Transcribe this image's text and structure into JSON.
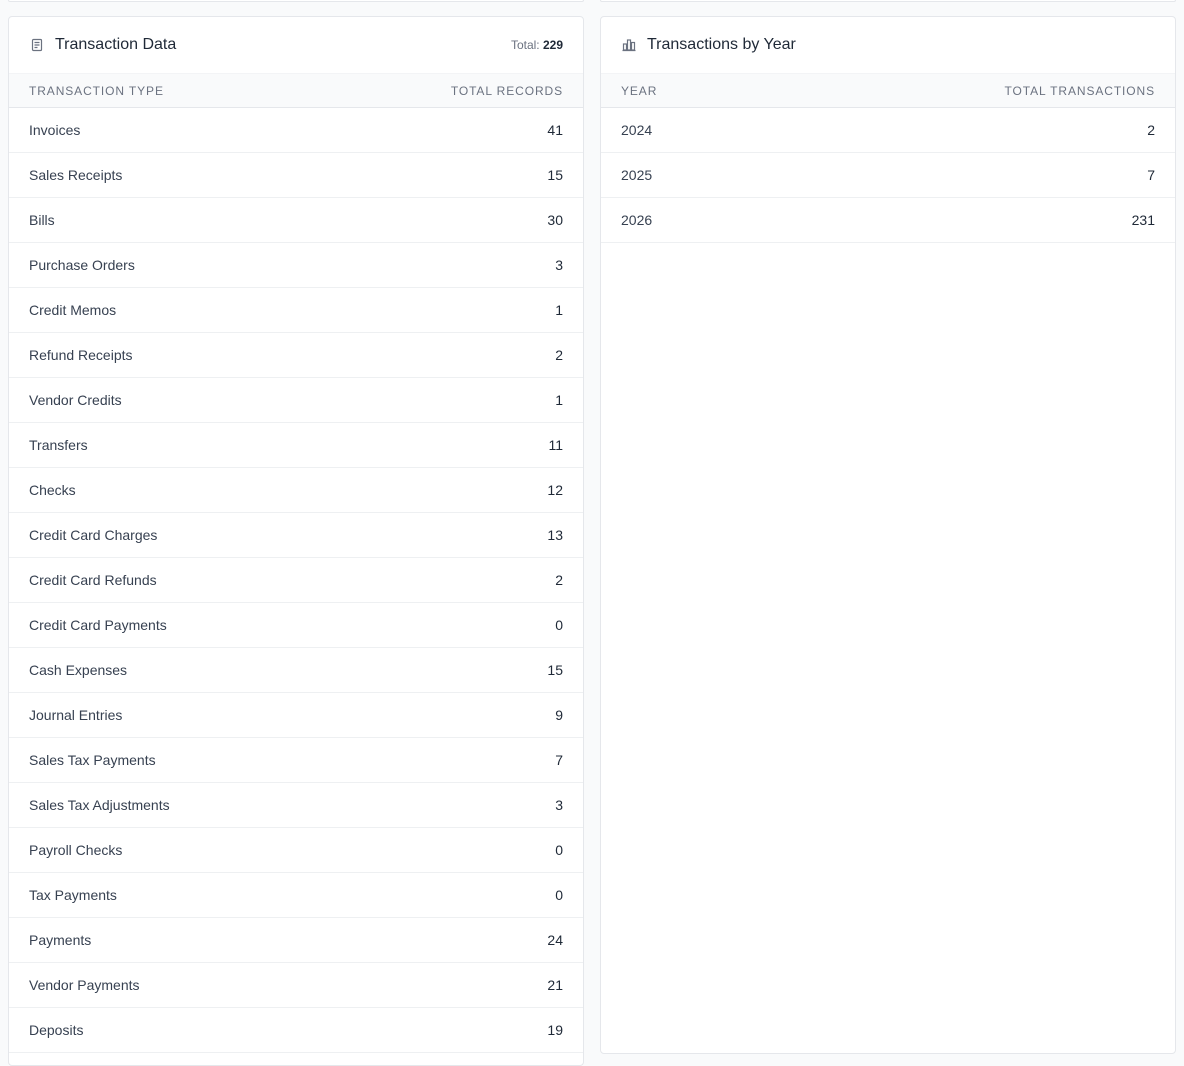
{
  "transaction_data": {
    "title": "Transaction Data",
    "total_label": "Total:",
    "total_value": "229",
    "columns": [
      "TRANSACTION TYPE",
      "TOTAL RECORDS"
    ],
    "rows": [
      {
        "type": "Invoices",
        "count": "41"
      },
      {
        "type": "Sales Receipts",
        "count": "15"
      },
      {
        "type": "Bills",
        "count": "30"
      },
      {
        "type": "Purchase Orders",
        "count": "3"
      },
      {
        "type": "Credit Memos",
        "count": "1"
      },
      {
        "type": "Refund Receipts",
        "count": "2"
      },
      {
        "type": "Vendor Credits",
        "count": "1"
      },
      {
        "type": "Transfers",
        "count": "11"
      },
      {
        "type": "Checks",
        "count": "12"
      },
      {
        "type": "Credit Card Charges",
        "count": "13"
      },
      {
        "type": "Credit Card Refunds",
        "count": "2"
      },
      {
        "type": "Credit Card Payments",
        "count": "0"
      },
      {
        "type": "Cash Expenses",
        "count": "15"
      },
      {
        "type": "Journal Entries",
        "count": "9"
      },
      {
        "type": "Sales Tax Payments",
        "count": "7"
      },
      {
        "type": "Sales Tax Adjustments",
        "count": "3"
      },
      {
        "type": "Payroll Checks",
        "count": "0"
      },
      {
        "type": "Tax Payments",
        "count": "0"
      },
      {
        "type": "Payments",
        "count": "24"
      },
      {
        "type": "Vendor Payments",
        "count": "21"
      },
      {
        "type": "Deposits",
        "count": "19"
      }
    ],
    "icon": "receipt-icon"
  },
  "transactions_by_year": {
    "title": "Transactions by Year",
    "columns": [
      "YEAR",
      "TOTAL TRANSACTIONS"
    ],
    "rows": [
      {
        "year": "2024",
        "count": "2"
      },
      {
        "year": "2025",
        "count": "7"
      },
      {
        "year": "2026",
        "count": "231"
      }
    ],
    "icon": "bar-chart-icon"
  },
  "colors": {
    "background": "#f9fafb",
    "card": "#ffffff",
    "border": "#e5e7eb",
    "text": "#374151",
    "muted": "#6b7280"
  }
}
